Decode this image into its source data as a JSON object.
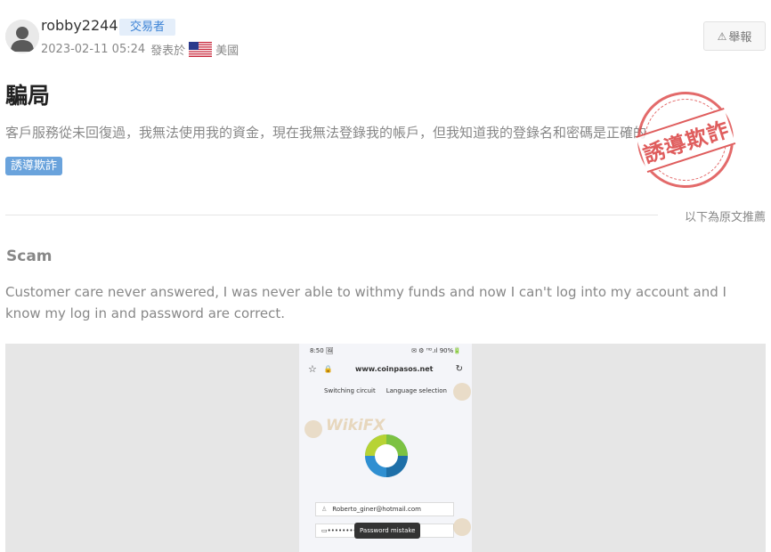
{
  "post": {
    "username": "robby2244",
    "role": "交易者",
    "date": "2023-02-11 05:24",
    "posted_in": "發表於",
    "country": "美國",
    "report_label": "舉報"
  },
  "content": {
    "title": "騙局",
    "summary": "客戶服務從未回復過，我無法使用我的資金，現在我無法登錄我的帳戶，但我知道我的登錄名和密碼是正確的",
    "tag": "誘導欺詐",
    "stamp": "誘導欺詐",
    "original_note": "以下為原文推薦"
  },
  "original": {
    "title": "Scam",
    "body": "Customer care never answered, I was never able to withmy funds and now I can't log into my account and I know my log in and password are correct."
  },
  "screenshot": {
    "status_left": "8:50 🖼",
    "status_right": "✉ ⚙ ᴴᴰ.ıl 90%🔋",
    "url": "www.coinpasos.net",
    "link_switch": "Switching circuit",
    "link_language": "Language selection",
    "email": "Roberto_giner@hotmail.com",
    "password_dots": "••••••••••",
    "toast": "Password mistake",
    "watermark": "WikiFX"
  },
  "colors": {
    "tag_bg": "#6aa3dc",
    "badge_bg": "#e4eefa",
    "badge_text": "#3e84d6",
    "stamp": "#d93a3a"
  }
}
